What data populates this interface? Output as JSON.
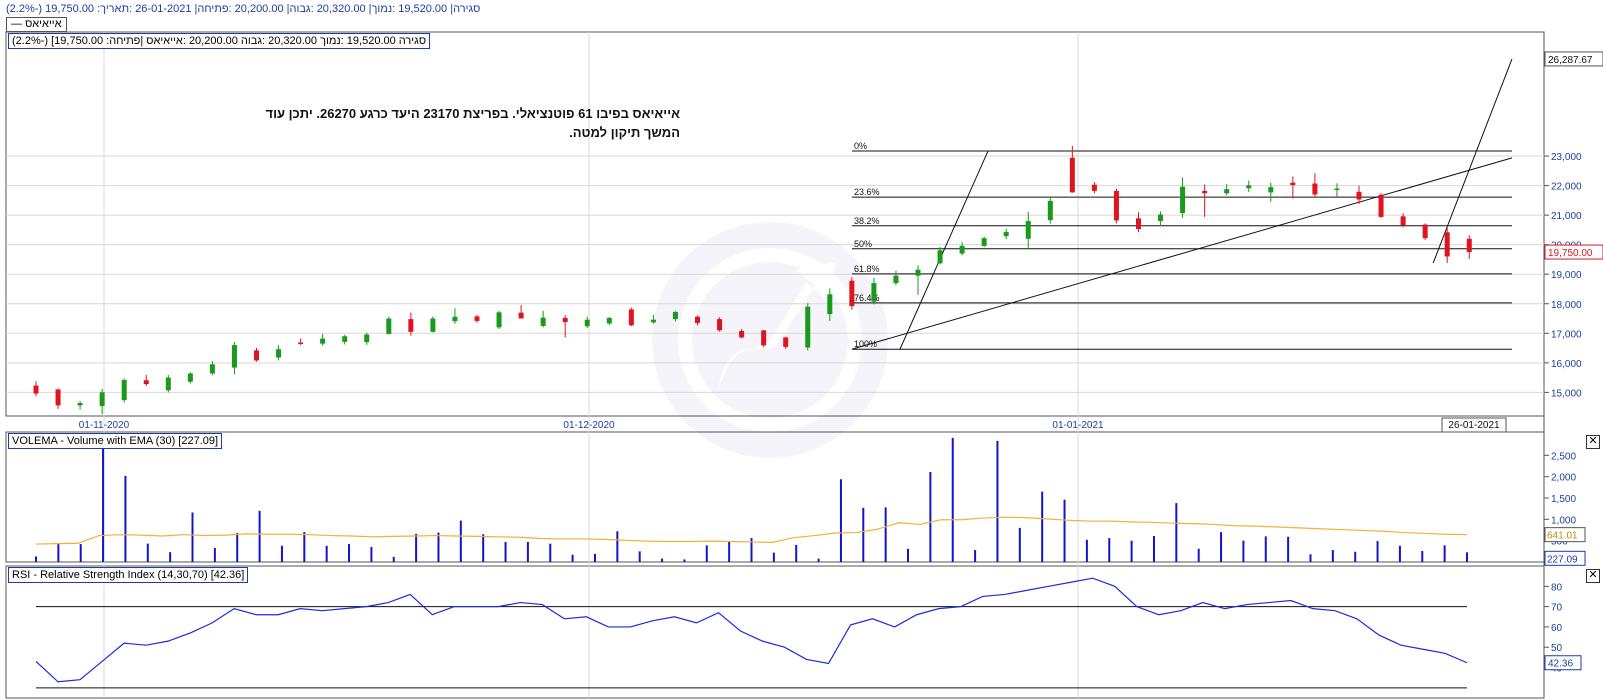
{
  "header": {
    "info_line": "(2.2%-) 19,750.00 :סגירה| 19,520.00 :נמוך| 20,320.00 :גבוה| 20,200.00 :פתיחה| 26-01-2021 :תאריך",
    "legend_label": "— אייאיאס"
  },
  "colors": {
    "up": "#1a9a1a",
    "down": "#e0141e",
    "volume": "#1414c8",
    "ema": "#f2b13a",
    "rsi": "#1e2adc",
    "axis_text": "#1a3fa0"
  },
  "watermark": {
    "icon": "trend-arrow-logo"
  },
  "price_panel": {
    "title": "(2.2%-) [19,750.00 :סגירה 19,520.00 :נמוך 20,320.00 :גבוה 20,200.00 :אייאיאס |פתיחה",
    "annotation_line1": "אייאיאס בפיבו 61 פוטנציאלי. בפריצת 23170 היעד כרגע 26270. יתכן עוד",
    "annotation_line2": "המשך תיקון למטה.",
    "last_price_label": "19,750.00",
    "target_label": "26,287.67",
    "date_highlight": "26-01-2021",
    "fib_levels": [
      {
        "label": "0%",
        "value": 23170
      },
      {
        "label": "23.6%",
        "value": 21610
      },
      {
        "label": "38.2%",
        "value": 20640
      },
      {
        "label": "50%",
        "value": 19860
      },
      {
        "label": "61.8%",
        "value": 19010
      },
      {
        "label": "76.4%",
        "value": 18030
      },
      {
        "label": "100%",
        "value": 16460
      }
    ]
  },
  "chart_data": [
    {
      "type": "candlestick",
      "title": "",
      "x_tick_labels": [
        "01-11-2020",
        "01-12-2020",
        "01-01-2021"
      ],
      "y_tick_labels": [
        "15,000",
        "16,000",
        "17,000",
        "18,000",
        "19,000",
        "20,000",
        "21,000",
        "22,000",
        "23,000"
      ],
      "ylim": [
        14200,
        27200
      ],
      "grid": true,
      "candles": [
        {
          "o": 15230,
          "h": 15380,
          "l": 14870,
          "c": 14960
        },
        {
          "o": 15100,
          "h": 15130,
          "l": 14440,
          "c": 14560
        },
        {
          "o": 14560,
          "h": 14700,
          "l": 14420,
          "c": 14640
        },
        {
          "o": 14540,
          "h": 15120,
          "l": 14260,
          "c": 15000
        },
        {
          "o": 14740,
          "h": 15470,
          "l": 14660,
          "c": 15420
        },
        {
          "o": 15410,
          "h": 15590,
          "l": 15220,
          "c": 15280
        },
        {
          "o": 15070,
          "h": 15590,
          "l": 15000,
          "c": 15500
        },
        {
          "o": 15360,
          "h": 15680,
          "l": 15300,
          "c": 15640
        },
        {
          "o": 15640,
          "h": 16060,
          "l": 15580,
          "c": 15950
        },
        {
          "o": 15840,
          "h": 16700,
          "l": 15610,
          "c": 16600
        },
        {
          "o": 16420,
          "h": 16500,
          "l": 16040,
          "c": 16080
        },
        {
          "o": 16180,
          "h": 16600,
          "l": 16080,
          "c": 16460
        },
        {
          "o": 16690,
          "h": 16820,
          "l": 16600,
          "c": 16640
        },
        {
          "o": 16650,
          "h": 16980,
          "l": 16580,
          "c": 16820
        },
        {
          "o": 16710,
          "h": 16950,
          "l": 16620,
          "c": 16900
        },
        {
          "o": 16700,
          "h": 17020,
          "l": 16610,
          "c": 16960
        },
        {
          "o": 16980,
          "h": 17560,
          "l": 16960,
          "c": 17500
        },
        {
          "o": 17480,
          "h": 17700,
          "l": 16920,
          "c": 17050
        },
        {
          "o": 17050,
          "h": 17570,
          "l": 17030,
          "c": 17500
        },
        {
          "o": 17410,
          "h": 17850,
          "l": 17330,
          "c": 17560
        },
        {
          "o": 17570,
          "h": 17620,
          "l": 17360,
          "c": 17420
        },
        {
          "o": 17200,
          "h": 17760,
          "l": 17150,
          "c": 17710
        },
        {
          "o": 17700,
          "h": 17960,
          "l": 17550,
          "c": 17500
        },
        {
          "o": 17250,
          "h": 17760,
          "l": 17200,
          "c": 17530
        },
        {
          "o": 17520,
          "h": 17620,
          "l": 16860,
          "c": 17380
        },
        {
          "o": 17240,
          "h": 17560,
          "l": 17180,
          "c": 17460
        },
        {
          "o": 17330,
          "h": 17550,
          "l": 17280,
          "c": 17520
        },
        {
          "o": 17810,
          "h": 17870,
          "l": 17240,
          "c": 17270
        },
        {
          "o": 17370,
          "h": 17620,
          "l": 17320,
          "c": 17460
        },
        {
          "o": 17480,
          "h": 17760,
          "l": 17400,
          "c": 17720
        },
        {
          "o": 17560,
          "h": 17600,
          "l": 17270,
          "c": 17350
        },
        {
          "o": 17480,
          "h": 17540,
          "l": 17060,
          "c": 17100
        },
        {
          "o": 17080,
          "h": 17140,
          "l": 16830,
          "c": 16860
        },
        {
          "o": 17100,
          "h": 17110,
          "l": 16540,
          "c": 16590
        },
        {
          "o": 16860,
          "h": 16880,
          "l": 16470,
          "c": 16540
        },
        {
          "o": 16520,
          "h": 18020,
          "l": 16420,
          "c": 17900
        },
        {
          "o": 17650,
          "h": 18520,
          "l": 17420,
          "c": 18320
        },
        {
          "o": 18780,
          "h": 18900,
          "l": 17800,
          "c": 17920
        },
        {
          "o": 18070,
          "h": 18880,
          "l": 17980,
          "c": 18700
        },
        {
          "o": 18700,
          "h": 19120,
          "l": 18620,
          "c": 18950
        },
        {
          "o": 18950,
          "h": 19300,
          "l": 18300,
          "c": 19150
        },
        {
          "o": 19370,
          "h": 19920,
          "l": 19330,
          "c": 19810
        },
        {
          "o": 19700,
          "h": 20090,
          "l": 19640,
          "c": 19960
        },
        {
          "o": 19960,
          "h": 20270,
          "l": 19920,
          "c": 20220
        },
        {
          "o": 20290,
          "h": 20540,
          "l": 20190,
          "c": 20430
        },
        {
          "o": 20200,
          "h": 21120,
          "l": 19860,
          "c": 20800
        },
        {
          "o": 20830,
          "h": 21580,
          "l": 20710,
          "c": 21480
        },
        {
          "o": 22940,
          "h": 23340,
          "l": 21760,
          "c": 21770
        },
        {
          "o": 22030,
          "h": 22120,
          "l": 21740,
          "c": 21820
        },
        {
          "o": 21820,
          "h": 21900,
          "l": 20720,
          "c": 20820
        },
        {
          "o": 20890,
          "h": 21100,
          "l": 20420,
          "c": 20530
        },
        {
          "o": 20800,
          "h": 21130,
          "l": 20620,
          "c": 21020
        },
        {
          "o": 21070,
          "h": 22280,
          "l": 20910,
          "c": 21960
        },
        {
          "o": 21820,
          "h": 22040,
          "l": 20940,
          "c": 21740
        },
        {
          "o": 21740,
          "h": 22050,
          "l": 21670,
          "c": 21880
        },
        {
          "o": 21910,
          "h": 22170,
          "l": 21780,
          "c": 22010
        },
        {
          "o": 21770,
          "h": 22100,
          "l": 21450,
          "c": 21950
        },
        {
          "o": 22100,
          "h": 22310,
          "l": 21560,
          "c": 22020
        },
        {
          "o": 22070,
          "h": 22420,
          "l": 21600,
          "c": 21700
        },
        {
          "o": 21900,
          "h": 22080,
          "l": 21610,
          "c": 21900
        },
        {
          "o": 21790,
          "h": 22000,
          "l": 21380,
          "c": 21530
        },
        {
          "o": 21690,
          "h": 21740,
          "l": 20910,
          "c": 20940
        },
        {
          "o": 20960,
          "h": 21070,
          "l": 20590,
          "c": 20660
        },
        {
          "o": 20680,
          "h": 20720,
          "l": 20160,
          "c": 20220
        },
        {
          "o": 20420,
          "h": 20580,
          "l": 19380,
          "c": 19600
        },
        {
          "o": 20200,
          "h": 20320,
          "l": 19520,
          "c": 19750
        }
      ]
    },
    {
      "type": "bar",
      "title": "VOLEMA - Volume with EMA (30) [227.09]",
      "y_tick_labels": [
        "500",
        "1,000",
        "1,500",
        "2,000",
        "2,500"
      ],
      "ylim": [
        0,
        3000
      ],
      "last_volume_label": "227.09",
      "last_ema_label": "641.01",
      "series": [
        {
          "name": "Volume",
          "values": [
            130,
            430,
            420,
            2870,
            2020,
            430,
            230,
            1160,
            330,
            680,
            1200,
            380,
            700,
            380,
            420,
            350,
            120,
            660,
            690,
            970,
            650,
            470,
            470,
            430,
            170,
            190,
            720,
            250,
            80,
            60,
            390,
            470,
            560,
            220,
            400,
            80,
            1940,
            1270,
            1280,
            310,
            2110,
            2910,
            280,
            2840,
            800,
            1650,
            1460,
            520,
            560,
            500,
            610,
            1380,
            310,
            700,
            500,
            600,
            590,
            180,
            280,
            240,
            490,
            380,
            260,
            390,
            227
          ]
        },
        {
          "name": "EMA",
          "values": [
            420,
            430,
            440,
            620,
            640,
            630,
            610,
            640,
            620,
            630,
            660,
            650,
            650,
            640,
            620,
            610,
            590,
            600,
            610,
            620,
            610,
            600,
            590,
            580,
            550,
            540,
            540,
            530,
            510,
            490,
            480,
            480,
            490,
            480,
            470,
            460,
            570,
            620,
            680,
            690,
            770,
            920,
            880,
            990,
            990,
            1030,
            1050,
            1040,
            1010,
            980,
            960,
            960,
            940,
            930,
            910,
            900,
            880,
            850,
            840,
            820,
            800,
            780,
            760,
            740,
            720,
            690,
            670,
            650,
            641
          ]
        }
      ]
    },
    {
      "type": "line",
      "title": "RSI - Relative Strength Index (14,30,70) [42.36]",
      "y_tick_labels": [
        "40",
        "50",
        "60",
        "70",
        "80"
      ],
      "ylim": [
        25,
        90
      ],
      "reference_lines": [
        30,
        70
      ],
      "last_value_label": "42.36",
      "series": [
        {
          "name": "RSI",
          "values": [
            43,
            33,
            34,
            43,
            52,
            51,
            53,
            57,
            62,
            69,
            66,
            66,
            69,
            68,
            69,
            70,
            72,
            76,
            66,
            70,
            70,
            70,
            72,
            71,
            64,
            65,
            60,
            60,
            63,
            65,
            62,
            67,
            58,
            53,
            50,
            44,
            42,
            61,
            64,
            60,
            66,
            69,
            70,
            75,
            76,
            78,
            80,
            82,
            84,
            80,
            70,
            66,
            68,
            72,
            69,
            71,
            72,
            73,
            69,
            68,
            64,
            56,
            51,
            49,
            47,
            42.36
          ]
        }
      ]
    }
  ]
}
